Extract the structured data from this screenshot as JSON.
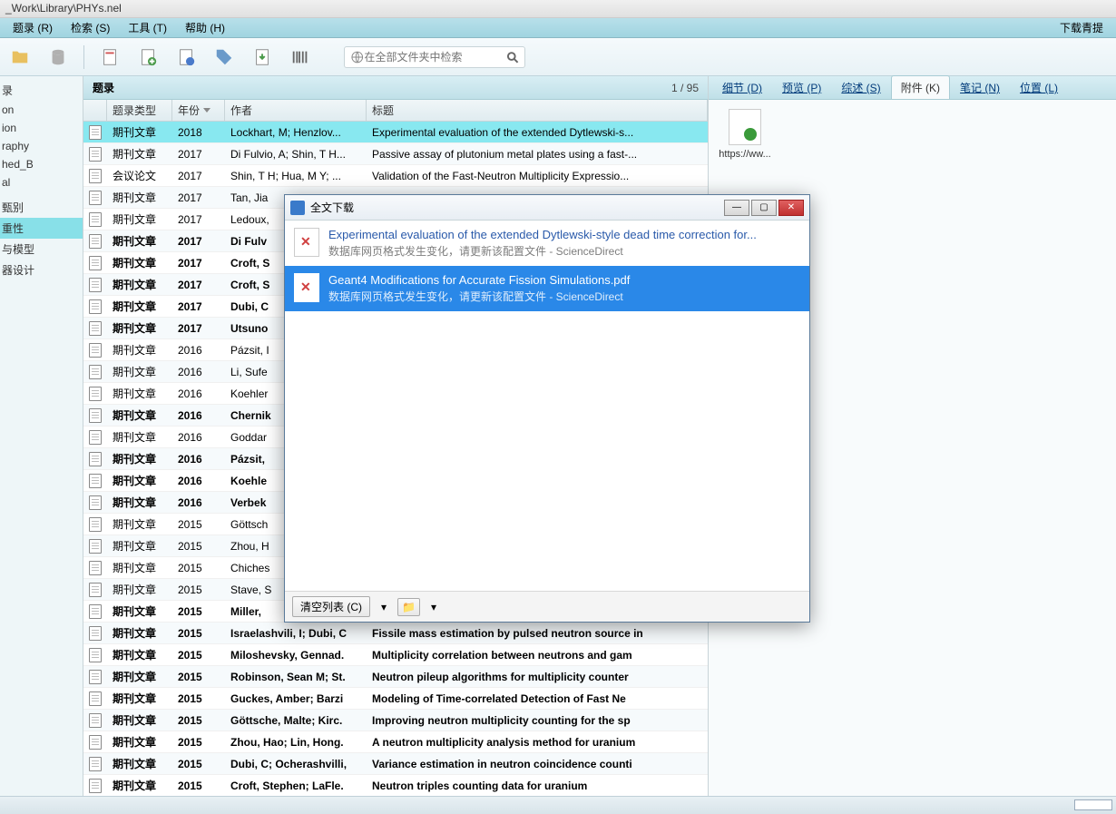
{
  "window_title": "_Work\\Library\\PHYs.nel",
  "menu": [
    "题录 (R)",
    "检索 (S)",
    "工具 (T)",
    "帮助 (H)"
  ],
  "menu_right": "下载青提",
  "search_placeholder": "在全部文件夹中检索",
  "center": {
    "title": "题录",
    "count": "1 / 95"
  },
  "columns": {
    "type": "题录类型",
    "year": "年份",
    "author": "作者",
    "title": "标题"
  },
  "sidebar": [
    "录",
    "on",
    "ion",
    "raphy",
    "hed_B",
    "al",
    "",
    "甄别",
    "重性",
    "与模型",
    "器设计"
  ],
  "sidebar_selected": 8,
  "rows": [
    {
      "type": "期刊文章",
      "year": "2018",
      "author": "Lockhart, M; Henzlov...",
      "title": "Experimental evaluation of the extended Dytlewski-s...",
      "sel": true
    },
    {
      "type": "期刊文章",
      "year": "2017",
      "author": "Di Fulvio, A; Shin, T H...",
      "title": "Passive assay of plutonium metal plates using a fast-..."
    },
    {
      "type": "会议论文",
      "year": "2017",
      "author": "Shin, T H; Hua, M Y; ...",
      "title": "Validation of the Fast-Neutron Multiplicity Expressio..."
    },
    {
      "type": "期刊文章",
      "year": "2017",
      "author": "Tan, Jia",
      "title": ""
    },
    {
      "type": "期刊文章",
      "year": "2017",
      "author": "Ledoux,",
      "title": ""
    },
    {
      "type": "期刊文章",
      "year": "2017",
      "author": "Di Fulv",
      "title": "",
      "bold": true
    },
    {
      "type": "期刊文章",
      "year": "2017",
      "author": "Croft, S",
      "title": "",
      "bold": true
    },
    {
      "type": "期刊文章",
      "year": "2017",
      "author": "Croft, S",
      "title": "",
      "bold": true
    },
    {
      "type": "期刊文章",
      "year": "2017",
      "author": "Dubi, C",
      "title": "",
      "bold": true
    },
    {
      "type": "期刊文章",
      "year": "2017",
      "author": "Utsuno",
      "title": "",
      "bold": true
    },
    {
      "type": "期刊文章",
      "year": "2016",
      "author": "Pázsit, I",
      "title": ""
    },
    {
      "type": "期刊文章",
      "year": "2016",
      "author": "Li, Sufe",
      "title": ""
    },
    {
      "type": "期刊文章",
      "year": "2016",
      "author": "Koehler",
      "title": ""
    },
    {
      "type": "期刊文章",
      "year": "2016",
      "author": "Chernik",
      "title": "",
      "bold": true
    },
    {
      "type": "期刊文章",
      "year": "2016",
      "author": "Goddar",
      "title": ""
    },
    {
      "type": "期刊文章",
      "year": "2016",
      "author": "Pázsit,",
      "title": "",
      "bold": true
    },
    {
      "type": "期刊文章",
      "year": "2016",
      "author": "Koehle",
      "title": "",
      "bold": true
    },
    {
      "type": "期刊文章",
      "year": "2016",
      "author": "Verbek",
      "title": "",
      "bold": true
    },
    {
      "type": "期刊文章",
      "year": "2015",
      "author": "Göttsch",
      "title": ""
    },
    {
      "type": "期刊文章",
      "year": "2015",
      "author": "Zhou, H",
      "title": ""
    },
    {
      "type": "期刊文章",
      "year": "2015",
      "author": "Chiches",
      "title": ""
    },
    {
      "type": "期刊文章",
      "year": "2015",
      "author": "Stave, S",
      "title": ""
    },
    {
      "type": "期刊文章",
      "year": "2015",
      "author": "Miller, ",
      "title": "",
      "bold": true
    },
    {
      "type": "期刊文章",
      "year": "2015",
      "author": "Israelashvili, I; Dubi, C",
      "title": "Fissile mass estimation by pulsed neutron source in",
      "bold": true
    },
    {
      "type": "期刊文章",
      "year": "2015",
      "author": "Miloshevsky, Gennad.",
      "title": "Multiplicity correlation between neutrons and gam",
      "bold": true
    },
    {
      "type": "期刊文章",
      "year": "2015",
      "author": "Robinson, Sean M; St.",
      "title": "Neutron pileup algorithms for multiplicity counter",
      "bold": true
    },
    {
      "type": "期刊文章",
      "year": "2015",
      "author": "Guckes, Amber; Barzi",
      "title": "Modeling of Time-correlated Detection of Fast Ne",
      "bold": true
    },
    {
      "type": "期刊文章",
      "year": "2015",
      "author": "Göttsche, Malte; Kirc.",
      "title": "Improving neutron multiplicity counting for the sp",
      "bold": true
    },
    {
      "type": "期刊文章",
      "year": "2015",
      "author": "Zhou, Hao; Lin, Hong.",
      "title": "A neutron multiplicity analysis method for uranium",
      "bold": true
    },
    {
      "type": "期刊文章",
      "year": "2015",
      "author": "Dubi, C; Ocherashvilli,",
      "title": "Variance estimation in neutron coincidence counti",
      "bold": true
    },
    {
      "type": "期刊文章",
      "year": "2015",
      "author": "Croft, Stephen; LaFle.",
      "title": "Neutron triples counting data for uranium",
      "bold": true
    }
  ],
  "tabs": [
    {
      "label": "细节 (D)"
    },
    {
      "label": "预览 (P)"
    },
    {
      "label": "综述 (S)"
    },
    {
      "label": "附件 (K)",
      "active": true
    },
    {
      "label": "笔记 (N)"
    },
    {
      "label": "位置 (L)"
    }
  ],
  "attachment_label": "https://ww...",
  "dialog": {
    "title": "全文下载",
    "items": [
      {
        "title": "Experimental evaluation of the extended Dytlewski-style dead time correction for...",
        "sub": "数据库网页格式发生变化，请更新该配置文件  -  ScienceDirect"
      },
      {
        "title": "Geant4 Modifications for Accurate Fission Simulations.pdf",
        "sub": "数据库网页格式发生变化，请更新该配置文件  -  ScienceDirect",
        "sel": true
      }
    ],
    "clear": "清空列表 (C)"
  }
}
